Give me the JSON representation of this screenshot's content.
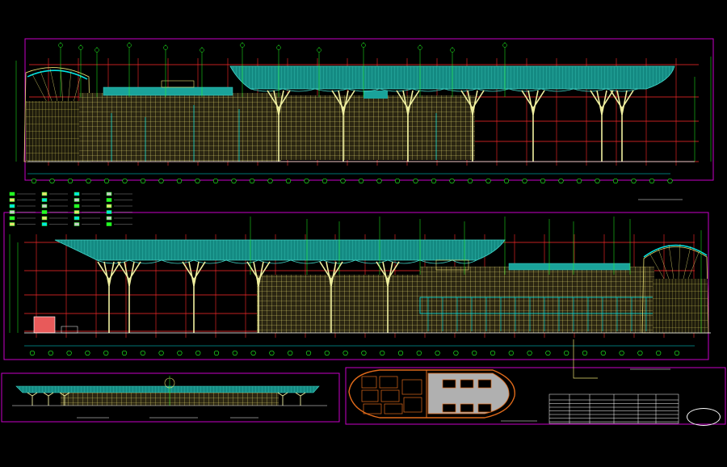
{
  "sheet": {
    "upper_title": "",
    "upper_subtitle": "",
    "lower_title": "",
    "lower_subtitle": "",
    "mini_elev_a": "",
    "mini_elev_b": "",
    "mini_elev_c": "",
    "plan_title": "",
    "table_title": "",
    "stamp_text": ""
  },
  "colors": {
    "background": "#000000",
    "sheet_border": "#c800c8",
    "grid": "#ff2a2a",
    "roof": "#1aa39a",
    "facade": "#e8e070",
    "mullion": "#00e5e5",
    "column": "#f0f0a0",
    "leader": "#22ff22",
    "plan": "#e06a1a"
  },
  "icons": {
    "stamp": "ellipse-stamp-icon",
    "grid_bubble": "grid-bubble-icon"
  }
}
